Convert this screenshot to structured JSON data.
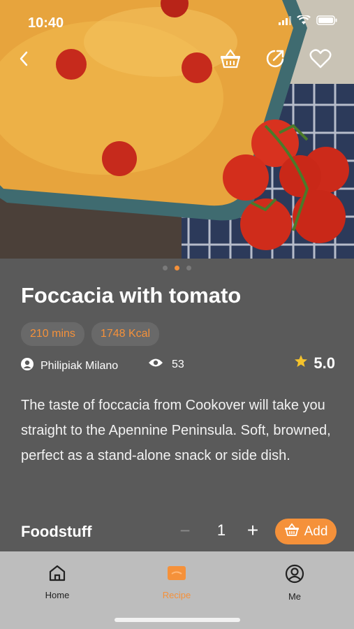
{
  "status_bar": {
    "time": "10:40"
  },
  "recipe": {
    "title": "Foccacia with tomato",
    "tags": [
      "210 mins",
      "1748 Kcal"
    ],
    "author": "Philipiak Milano",
    "views": "53",
    "rating": "5.0",
    "description": "The taste of foccacia from Cookover will take you straight to the Apennine Peninsula. Soft, browned, perfect as a stand-alone snack or side dish."
  },
  "carousel": {
    "count": 3,
    "active_index": 1
  },
  "foodstuff": {
    "title": "Foodstuff",
    "quantity": "1",
    "minus_label": "−",
    "plus_label": "+",
    "add_label": "Add"
  },
  "tabbar": {
    "tabs": [
      {
        "label": "Home",
        "icon": "home-icon"
      },
      {
        "label": "Recipe",
        "icon": "recipe-icon"
      },
      {
        "label": "Me",
        "icon": "profile-icon"
      }
    ],
    "active_index": 1
  },
  "colors": {
    "accent": "#f5913a",
    "background": "#5a5a5a",
    "tabbar": "#bdbdbd"
  }
}
